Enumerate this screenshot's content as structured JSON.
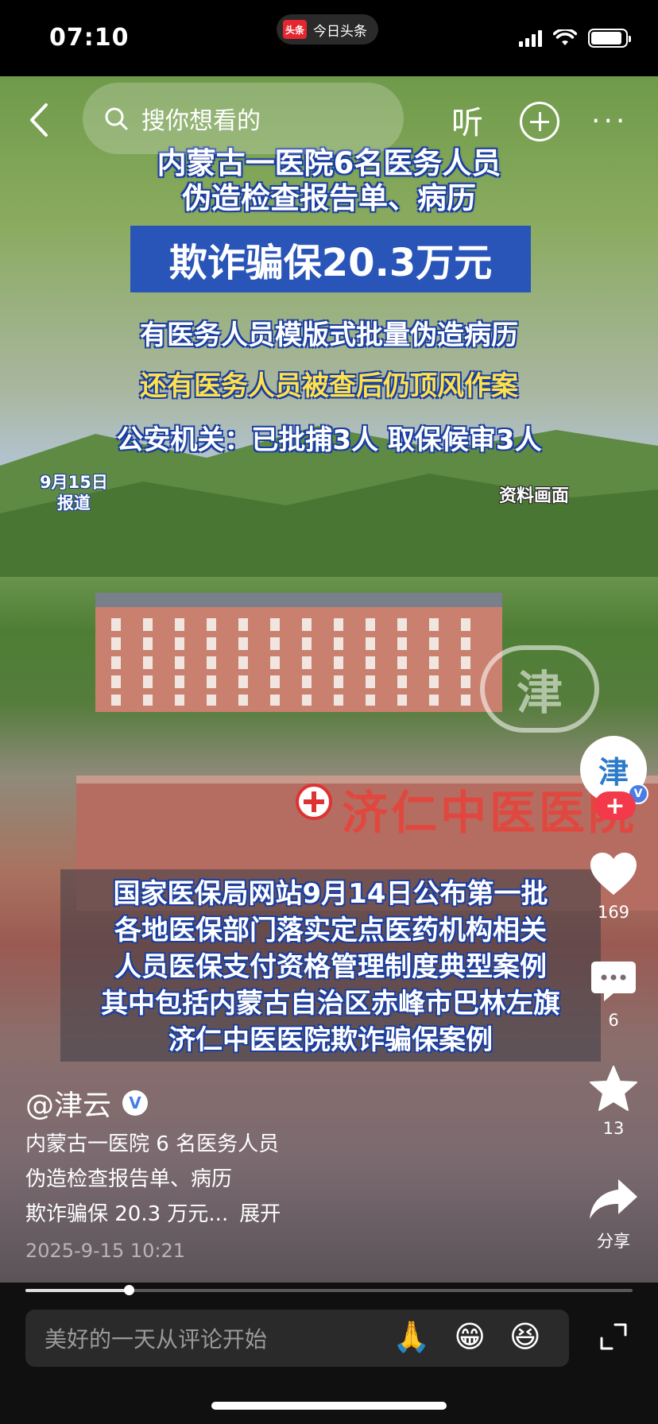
{
  "status_bar": {
    "time": "07:10",
    "app_logo": "头条",
    "app_name": "今日头条",
    "battery_level": 0.9
  },
  "nav": {
    "search_placeholder": "搜你想看的",
    "listen_label": "听",
    "back_icon": "chevron-left-icon",
    "more_icon": "more-horizontal-icon"
  },
  "video": {
    "headline_1": "内蒙古一医院6名医务人员",
    "headline_2": "伪造检查报告单、病历",
    "headline_box": "欺诈骗保20.3万元",
    "headline_3": "有医务人员模版式批量伪造病历",
    "headline_4": "还有医务人员被查后仍顶风作案",
    "headline_5": "公安机关：已批捕3人 取保候审3人",
    "date_line_1": "9月15日",
    "date_line_2": "报道",
    "source_tag": "资料画面",
    "hospital_sign": "济仁中医医院",
    "watermark": "津",
    "caption_lines": [
      "国家医保局网站9月14日公布第一批",
      "各地医保部门落实定点医药机构相关",
      "人员医保支付资格管理制度典型案例",
      "其中包括内蒙古自治区赤峰市巴林左旗",
      "济仁中医医院欺诈骗保案例"
    ]
  },
  "actions": {
    "avatar_text": "津",
    "verified_mark": "V",
    "follow_label": "+",
    "likes": "169",
    "comments": "6",
    "favorites": "13",
    "share_label": "分享"
  },
  "post": {
    "author": "@津云",
    "desc_line_1": "内蒙古一医院 6 名医务人员",
    "desc_line_2": "伪造检查报告单、病历",
    "desc_line_3": "欺诈骗保 20.3 万元...",
    "expand_label": "展开",
    "date": "2025-9-15 10:21"
  },
  "player": {
    "progress": 0.17
  },
  "bottom": {
    "comment_placeholder": "美好的一天从评论开始",
    "emojis": [
      "🙏",
      "😁",
      "😆"
    ]
  },
  "colors": {
    "like_red": "#f23a4a",
    "caption_blue": "#2a55b8",
    "highlight_yellow": "#ffe14a"
  }
}
